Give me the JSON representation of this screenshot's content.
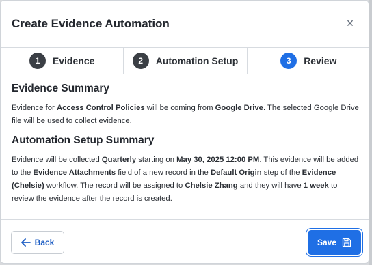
{
  "modal": {
    "title": "Create Evidence Automation",
    "close_symbol": "×"
  },
  "steps": [
    {
      "number": "1",
      "label": "Evidence",
      "state": "completed"
    },
    {
      "number": "2",
      "label": "Automation Setup",
      "state": "completed"
    },
    {
      "number": "3",
      "label": "Review",
      "state": "active"
    }
  ],
  "evidence_summary": {
    "title": "Evidence Summary",
    "t1": "Evidence for ",
    "policy": "Access Control Policies",
    "t2": " will be coming from ",
    "source": "Google Drive",
    "t3": ". The selected Google Drive file will be used to collect evidence."
  },
  "automation_summary": {
    "title": "Automation Setup Summary",
    "t1": "Evidence will be collected ",
    "frequency": "Quarterly",
    "t2": " starting on ",
    "start": "May 30, 2025 12:00 PM",
    "t3": ". This evidence will be added to the ",
    "field": "Evidence Attachments",
    "t4": " field of a new record in the ",
    "step": "Default Origin",
    "t5": " step of the ",
    "workflow": "Evidence (Chelsie)",
    "t6": " workflow. The record will be assigned to ",
    "assignee": "Chelsie Zhang",
    "t7": " and they will have ",
    "duration": "1 week",
    "t8": " to review the evidence after the record is created."
  },
  "footer": {
    "back_label": "Back",
    "save_label": "Save"
  },
  "colors": {
    "accent": "#1f6fe5",
    "step_inactive": "#3b3f45"
  },
  "icons": {
    "back": "arrow-left-icon",
    "save": "floppy-disk-icon",
    "close": "close-icon"
  }
}
